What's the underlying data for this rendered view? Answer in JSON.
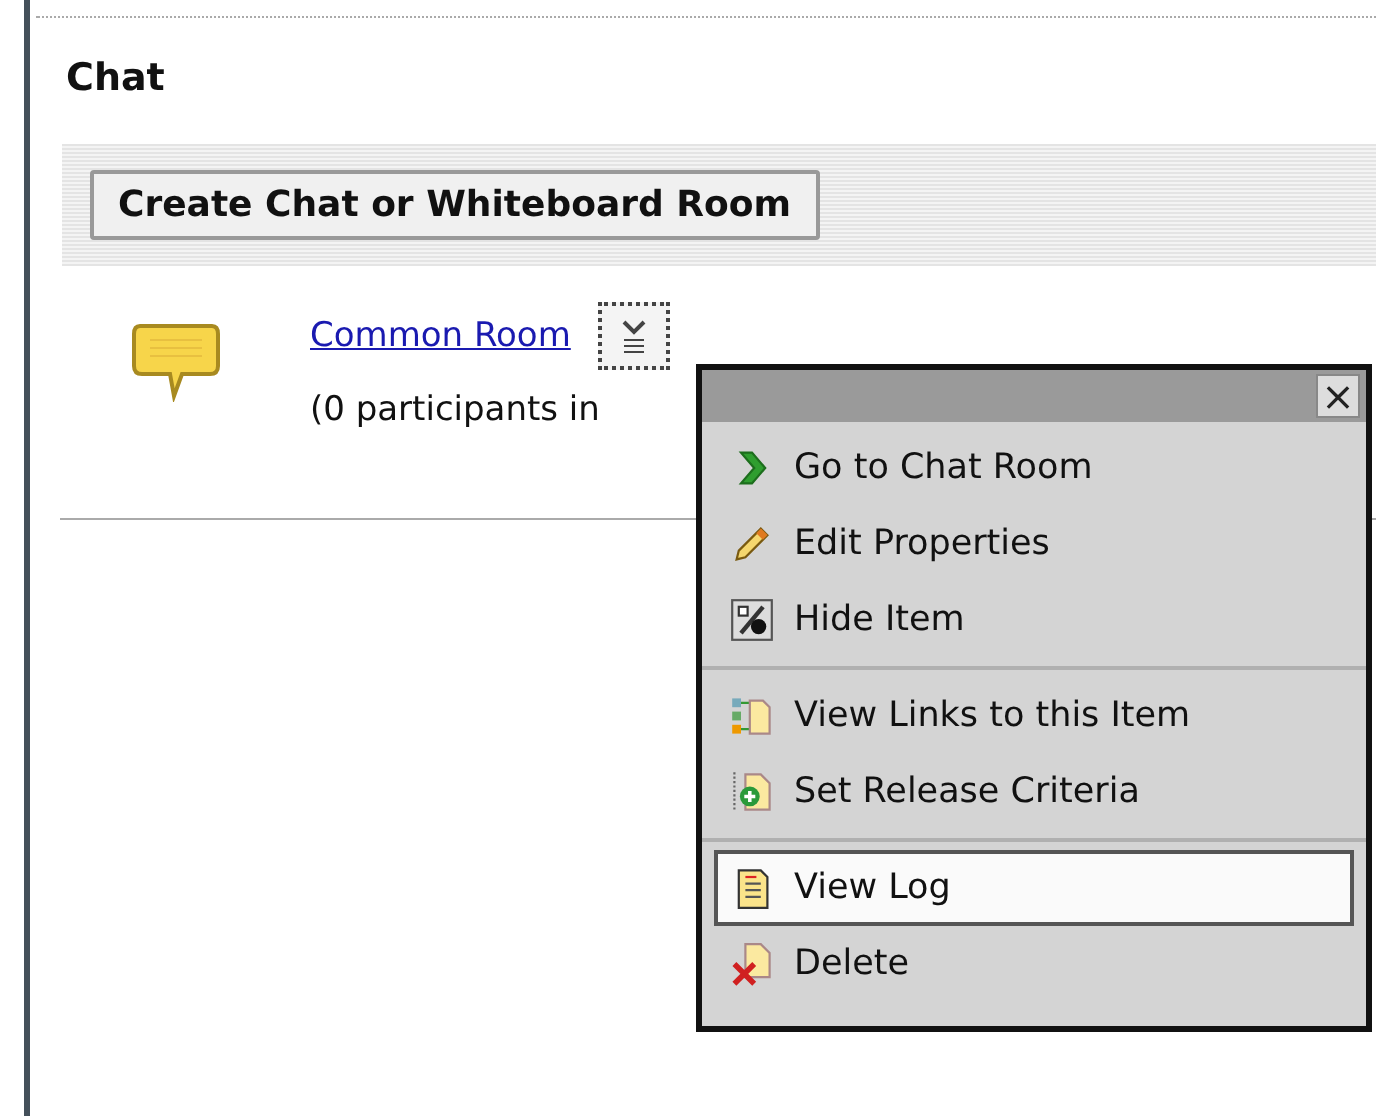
{
  "page": {
    "title": "Chat"
  },
  "toolbar": {
    "button": "Create Chat or Whiteboard Room"
  },
  "rooms": [
    {
      "name": "Common Room",
      "status": "(0 participants in"
    }
  ],
  "context_menu": {
    "close": "×",
    "groups": [
      {
        "items": [
          {
            "kind": "go",
            "label": "Go to Chat Room",
            "selected": false
          },
          {
            "kind": "edit",
            "label": "Edit Properties",
            "selected": false
          },
          {
            "kind": "hide",
            "label": "Hide Item",
            "selected": false
          }
        ]
      },
      {
        "items": [
          {
            "kind": "links",
            "label": "View Links to this Item",
            "selected": false
          },
          {
            "kind": "release",
            "label": "Set Release Criteria",
            "selected": false
          }
        ]
      },
      {
        "items": [
          {
            "kind": "log",
            "label": "View Log",
            "selected": true
          },
          {
            "kind": "delete",
            "label": "Delete",
            "selected": false
          }
        ]
      }
    ]
  }
}
